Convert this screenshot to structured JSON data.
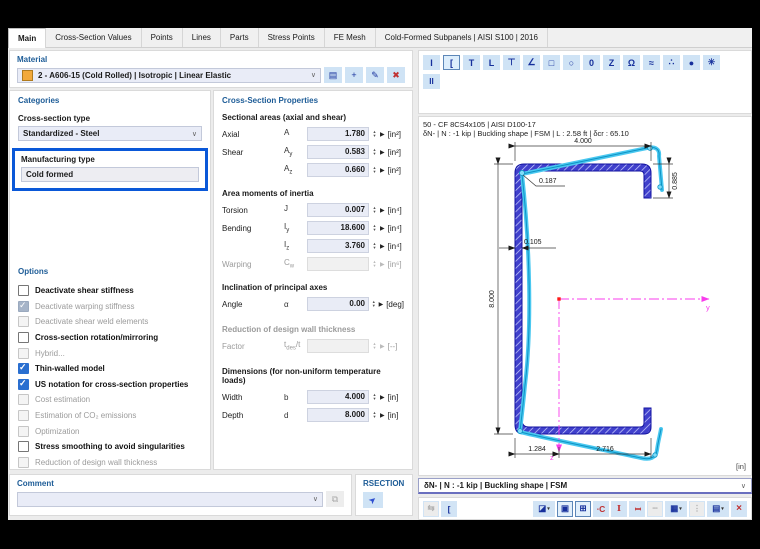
{
  "tabs": [
    "Main",
    "Cross-Section Values",
    "Points",
    "Lines",
    "Parts",
    "Stress Points",
    "FE Mesh",
    "Cold-Formed Subpanels | AISI S100 | 2016"
  ],
  "active_tab": "Main",
  "material": {
    "header": "Material",
    "value": "2 - A606-15 (Cold Rolled) | Isotropic | Linear Elastic",
    "swatch_color": "#f2a93b",
    "buttons": [
      {
        "name": "material-library",
        "glyph": "▤"
      },
      {
        "name": "new-material",
        "glyph": "+"
      },
      {
        "name": "edit-material",
        "glyph": "✎"
      },
      {
        "name": "delete-material",
        "glyph": "✖"
      }
    ]
  },
  "categories": {
    "header": "Categories",
    "cross_section_type": {
      "label": "Cross-section type",
      "value": "Standardized - Steel"
    },
    "manufacturing_type": {
      "label": "Manufacturing type",
      "value": "Cold formed"
    },
    "highlight_color": "#0a58d8"
  },
  "options": {
    "header": "Options",
    "items": [
      {
        "label": "Deactivate shear stiffness",
        "checked": false,
        "disabled": false
      },
      {
        "label": "Deactivate warping stiffness",
        "checked": true,
        "disabled": true
      },
      {
        "label": "Deactivate shear weld elements",
        "checked": false,
        "disabled": true
      },
      {
        "label": "Cross-section rotation/mirroring",
        "checked": false,
        "disabled": false
      },
      {
        "label": "Hybrid...",
        "checked": false,
        "disabled": true
      },
      {
        "label": "Thin-walled model",
        "checked": true,
        "disabled": false
      },
      {
        "label": "US notation for cross-section properties",
        "checked": true,
        "disabled": false
      },
      {
        "label": "Cost estimation",
        "checked": false,
        "disabled": true
      },
      {
        "label": "Estimation of CO₂ emissions",
        "checked": false,
        "disabled": true
      },
      {
        "label": "Optimization",
        "checked": false,
        "disabled": true
      },
      {
        "label": "Stress smoothing to avoid singularities",
        "checked": false,
        "disabled": false
      },
      {
        "label": "Reduction of design wall thickness",
        "checked": false,
        "disabled": true
      }
    ]
  },
  "properties": {
    "header": "Cross-Section Properties",
    "groups": [
      {
        "title": "Sectional areas (axial and shear)",
        "rows": [
          {
            "label": "Axial",
            "sym": "A",
            "value": "1.780",
            "unit": "[in²]"
          },
          {
            "label": "Shear",
            "sym": "A",
            "sub": "y",
            "value": "0.583",
            "unit": "[in²]"
          },
          {
            "label": "",
            "sym": "A",
            "sub": "z",
            "value": "0.660",
            "unit": "[in²]"
          }
        ]
      },
      {
        "title": "Area moments of inertia",
        "rows": [
          {
            "label": "Torsion",
            "sym": "J",
            "value": "0.007",
            "unit": "[in⁴]"
          },
          {
            "label": "Bending",
            "sym": "I",
            "sub": "y",
            "value": "18.600",
            "unit": "[in⁴]"
          },
          {
            "label": "",
            "sym": "I",
            "sub": "z",
            "value": "3.760",
            "unit": "[in⁴]"
          },
          {
            "label": "Warping",
            "sym": "C",
            "sub": "w",
            "value": "",
            "unit": "[in⁶]"
          }
        ]
      },
      {
        "title": "Inclination of principal axes",
        "rows": [
          {
            "label": "Angle",
            "sym": "α",
            "value": "0.00",
            "unit": "[deg]"
          }
        ]
      },
      {
        "title": "Reduction of design wall thickness",
        "rows": [
          {
            "label": "Factor",
            "sym": "t",
            "sub": "des",
            "post": "/t",
            "value": "",
            "unit": "[--]"
          }
        ]
      },
      {
        "title": "Dimensions (for non-uniform temperature loads)",
        "rows": [
          {
            "label": "Width",
            "sym": "b",
            "value": "4.000",
            "unit": "[in]"
          },
          {
            "label": "Depth",
            "sym": "d",
            "value": "8.000",
            "unit": "[in]"
          }
        ]
      }
    ]
  },
  "comment": {
    "header": "Comment",
    "value": ""
  },
  "rsection": {
    "label": "RSECTION"
  },
  "section_toolbar": {
    "row1": [
      {
        "name": "i-section",
        "glyph": "I",
        "selected": false
      },
      {
        "name": "c-section",
        "glyph": "[",
        "selected": true
      },
      {
        "name": "t-section",
        "glyph": "T",
        "selected": false
      },
      {
        "name": "l-section",
        "glyph": "L",
        "selected": false
      },
      {
        "name": "hat-section",
        "glyph": "⊤",
        "selected": false
      },
      {
        "name": "angle-section",
        "glyph": "∠",
        "selected": false
      },
      {
        "name": "box-section",
        "glyph": "□",
        "selected": false
      },
      {
        "name": "round-section",
        "glyph": "○",
        "selected": false
      },
      {
        "name": "pipe-section",
        "glyph": "0",
        "selected": false
      },
      {
        "name": "z-section",
        "glyph": "Z",
        "selected": false
      },
      {
        "name": "omega-section",
        "glyph": "Ω",
        "selected": false
      },
      {
        "name": "corrugated-section",
        "glyph": "≈",
        "selected": false
      },
      {
        "name": "point-section",
        "glyph": "∴",
        "selected": false
      },
      {
        "name": "solid-round-section",
        "glyph": "●",
        "selected": false
      },
      {
        "name": "star-section",
        "glyph": "✳",
        "selected": false
      }
    ],
    "row2": [
      {
        "name": "double-i-section",
        "glyph": "II",
        "selected": false
      }
    ]
  },
  "drawing": {
    "title": "50 - CF 8CS4x105 | AISI D100-17",
    "subtitle": "δN- | N : -1 kip | Buckling shape | FSM | L : 2.58 ft | δcr : 65.10",
    "unit_label": "[in]",
    "dims": {
      "width": "4.000",
      "lip": "0.885",
      "radius": "0.187",
      "thickness": "0.105",
      "depth": "8.000",
      "bottom_left": "1.284",
      "bottom_right": "2.716"
    },
    "axes": {
      "y": "y",
      "z": "z"
    },
    "colors": {
      "section": "#4040cc",
      "deformed": "#4ac8f0",
      "axis": "#f83cec"
    }
  },
  "result_bar": {
    "value": "δN- | N : -1 kip | Buckling shape | FSM"
  },
  "bottom_toolbar": {
    "left": [
      {
        "name": "sync-section",
        "glyph": "⇆",
        "disabled": true
      },
      {
        "name": "c-profile",
        "glyph": "[",
        "disabled": false
      }
    ],
    "right": [
      {
        "name": "render-mode",
        "glyph": "◪",
        "caret": "▾"
      },
      {
        "name": "show-section",
        "glyph": "▣",
        "selected": true
      },
      {
        "name": "show-effective-parts",
        "glyph": "⊞",
        "selected": true
      },
      {
        "name": "show-stress-points",
        "glyph": "∙C"
      },
      {
        "name": "show-dimensions",
        "glyph": "I",
        "red": true
      },
      {
        "name": "show-axes",
        "glyph": "I",
        "red": true
      },
      {
        "name": "show-weld-lines",
        "glyph": "╌",
        "disabled": true
      },
      {
        "name": "show-table",
        "glyph": "▦",
        "caret": "▾"
      },
      {
        "name": "show-details",
        "glyph": "⋮",
        "disabled": true
      },
      {
        "name": "print",
        "glyph": "▤",
        "caret": "▾"
      },
      {
        "name": "close-zoom",
        "glyph": "×",
        "red": true
      }
    ]
  }
}
